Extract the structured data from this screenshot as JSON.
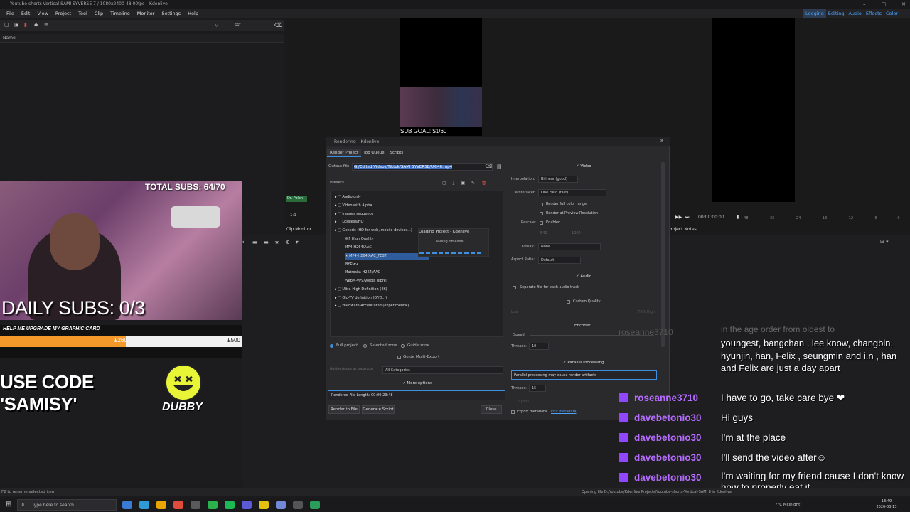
{
  "window": {
    "title": "Youtube-shorts-Vertical-SAMI SYVERSE 7 / 1080x2400-48.00fps – Kdenlive",
    "controls": [
      "–",
      "□",
      "✕"
    ]
  },
  "menu": [
    "File",
    "Edit",
    "View",
    "Project",
    "Tool",
    "Clip",
    "Timeline",
    "Monitor",
    "Settings",
    "Help"
  ],
  "mode_tabs": [
    "Logging",
    "Editing",
    "Audio",
    "Effects",
    "Color"
  ],
  "bin": {
    "search_value": "ssf",
    "column_name": "Name"
  },
  "monitors": {
    "clip_tab": "Clip Monitor",
    "project_tab": "Project Notes",
    "timecode": "00:00:00:00",
    "ruler_ticks": [
      "-48",
      "-36",
      "-24",
      "-18",
      "-12",
      "-6",
      "0"
    ],
    "hint_label": "1:1",
    "blue_label": "Dr. Polen"
  },
  "overlay": {
    "sub_goal": "SUB GOAL: $1/60",
    "total_subs": "TOTAL SUBS: 64/70",
    "daily_subs": "DAILY SUBS: 0/3",
    "goal_title": "HELP ME UPGRADE MY GRAPHIC CARD",
    "goal_current": "£260",
    "goal_target": "£500",
    "goal_progress": 0.52,
    "use_code": "USE CODE 'SAMISY'",
    "dubby": "DUBBY"
  },
  "dialog": {
    "title": "Rendering – Kdenlive",
    "tabs": [
      "Render Project",
      "Job Queue",
      "Scripts"
    ],
    "output_label": "Output file",
    "output_value": "G:/Edited Videos/Tiktok/SAMI SYVERSE/UK-40.mp4",
    "presets_label": "Presets",
    "presets": [
      {
        "label": "Audio only",
        "level": 0
      },
      {
        "label": "Video with Alpha",
        "level": 0
      },
      {
        "label": "Images sequence",
        "level": 0
      },
      {
        "label": "Lossless/HQ",
        "level": 0
      },
      {
        "label": "Generic (HD for web, mobile devices...)",
        "level": 0
      },
      {
        "label": "GIF High Quality",
        "level": 1
      },
      {
        "label": "MP4-H264/AAC",
        "level": 1
      },
      {
        "label": "★ MP4-H264/AAC_TEST",
        "level": 1,
        "selected": true
      },
      {
        "label": "MPEG-2",
        "level": 1
      },
      {
        "label": "Matroska-H264/AAC",
        "level": 1
      },
      {
        "label": "WebM-VP9/Vorbis (libre)",
        "level": 1
      },
      {
        "label": "Ultra-High Definition (4K)",
        "level": 0
      },
      {
        "label": "Old-TV definition (DVD...)",
        "level": 0
      },
      {
        "label": "Hardware Accelerated (experimental)",
        "level": 0
      }
    ],
    "loading_title": "Loading Project - Kdenlive",
    "loading_text": "Loading timeline...",
    "zone": {
      "full": "Full project",
      "selected": "Selected zone",
      "guide": "Guide zone"
    },
    "guide_multi": "Guide Multi-Export",
    "guides_label": "Guides to use as separator",
    "guide_category": "All Categories",
    "more_options": "More options",
    "render_length": "Rendered File Length: 00:00:23:48",
    "btn_render": "Render to File",
    "btn_script": "Generate Script",
    "btn_close": "Close",
    "settings": {
      "video_section": "Video",
      "interpolation_label": "Interpolation:",
      "interpolation_value": "Bilinear (good)",
      "deinterlacer_label": "Deinterlacer:",
      "deinterlacer_value": "One Field (fast)",
      "render_full_color": "Render full color range",
      "render_preview_res": "Render at Preview Resolution",
      "rescale_label": "Rescale:",
      "rescale_enabled": "Enabled",
      "rescale_w": "540",
      "rescale_h": "1200",
      "overlay_label": "Overlay:",
      "overlay_value": "None",
      "aspect_label": "Aspect Ratio:",
      "aspect_value": "Default",
      "audio_section": "Audio",
      "separate_audio": "Separate file for each audio track",
      "custom_quality": "Custom Quality",
      "quality_low": "Low",
      "quality_high": "75% High",
      "encoder_section": "Encoder",
      "speed_label": "Speed:",
      "threads_label": "Threads:",
      "threads_value": "10",
      "parallel_section": "Parallel Processing",
      "parallel_warning": "Parallel processing may cause render artifacts",
      "threads2_label": "Threads:",
      "threads2_value": "15",
      "passes": "2 pass",
      "export_metadata": "Export metadata",
      "edit_metadata": "Edit metadata"
    }
  },
  "chat": {
    "faded_line": "in the age order from oldest to",
    "top_message": "youngest, bangchan , lee know, changbin, hyunjin, han, Felix , seungmin and i.n , han and Felix are just a day apart",
    "messages": [
      {
        "user": "roseanne3710",
        "text": "I have to go, take care bye ❤"
      },
      {
        "user": "davebetonio30",
        "text": "Hi guys"
      },
      {
        "user": "davebetonio30",
        "text": "I'm at the place"
      },
      {
        "user": "davebetonio30",
        "text": "I'll send the video after☺"
      },
      {
        "user": "davebetonio30",
        "text": "I'm waiting for my friend cause I don't know how to properly eat it"
      }
    ],
    "faded_user": "roseanne3710"
  },
  "status": {
    "left": "F2 to rename selected item",
    "right": "Opening file D:/Youtube/Kdenlive Projects/Youtube-shorts-Vertical-SAMI 8 in Kdenlive"
  },
  "taskbar": {
    "search_placeholder": "Type here to search",
    "weather": "7°C  Mcinight",
    "time": "13:49",
    "date": "2026-03-13",
    "app_colors": [
      "#3a7bd5",
      "#2f9bd6",
      "#e8a400",
      "#e14b3b",
      "#5a5a5a",
      "#2bb24c",
      "#1db954",
      "#5b5bd6",
      "#e2c10f",
      "#7289da",
      "#555",
      "#2b9d5a"
    ]
  }
}
